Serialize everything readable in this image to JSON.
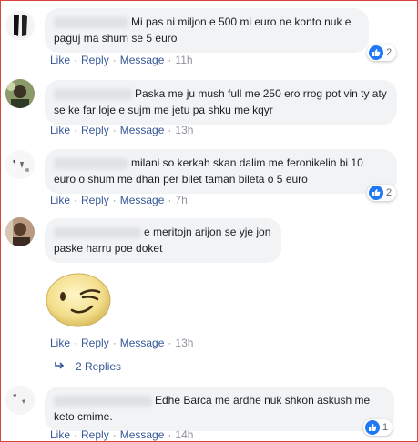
{
  "comments": [
    {
      "text": "Mi pas ni miljon e 500 mi euro ne konto nuk e paguj ma shum se 5 euro",
      "actions": {
        "like": "Like",
        "reply": "Reply",
        "message": "Message",
        "time": "11h"
      },
      "reactions": "2"
    },
    {
      "text": "Paska me ju mush full me 250 ero rrog pot vin ty aty se ke far loje e sujm me jetu pa shku me kqyr",
      "actions": {
        "like": "Like",
        "reply": "Reply",
        "message": "Message",
        "time": "13h"
      }
    },
    {
      "text": "milani so kerkah skan dalim me feronikelin bi 10 euro o shum me dhan per bilet taman bileta o 5 euro",
      "actions": {
        "like": "Like",
        "reply": "Reply",
        "message": "Message",
        "time": "7h"
      },
      "reactions": "2"
    },
    {
      "text": "e meritojn arijon se yje jon paske harru poe doket",
      "actions": {
        "like": "Like",
        "reply": "Reply",
        "message": "Message",
        "time": "13h"
      },
      "replies": "2 Replies"
    },
    {
      "text": "Edhe Barca me ardhe nuk shkon askush me keto cmime.",
      "actions": {
        "like": "Like",
        "reply": "Reply",
        "message": "Message",
        "time": "14h"
      },
      "reactions": "1"
    }
  ],
  "icons": {
    "reaction": "like-thumb-icon",
    "sticker": "winking-face-sticker",
    "replies": "reply-arrow-icon"
  },
  "colors": {
    "link": "#385898",
    "bubble": "#f2f3f5",
    "like_blue": "#2078f4",
    "frame_border": "#d9453b"
  }
}
